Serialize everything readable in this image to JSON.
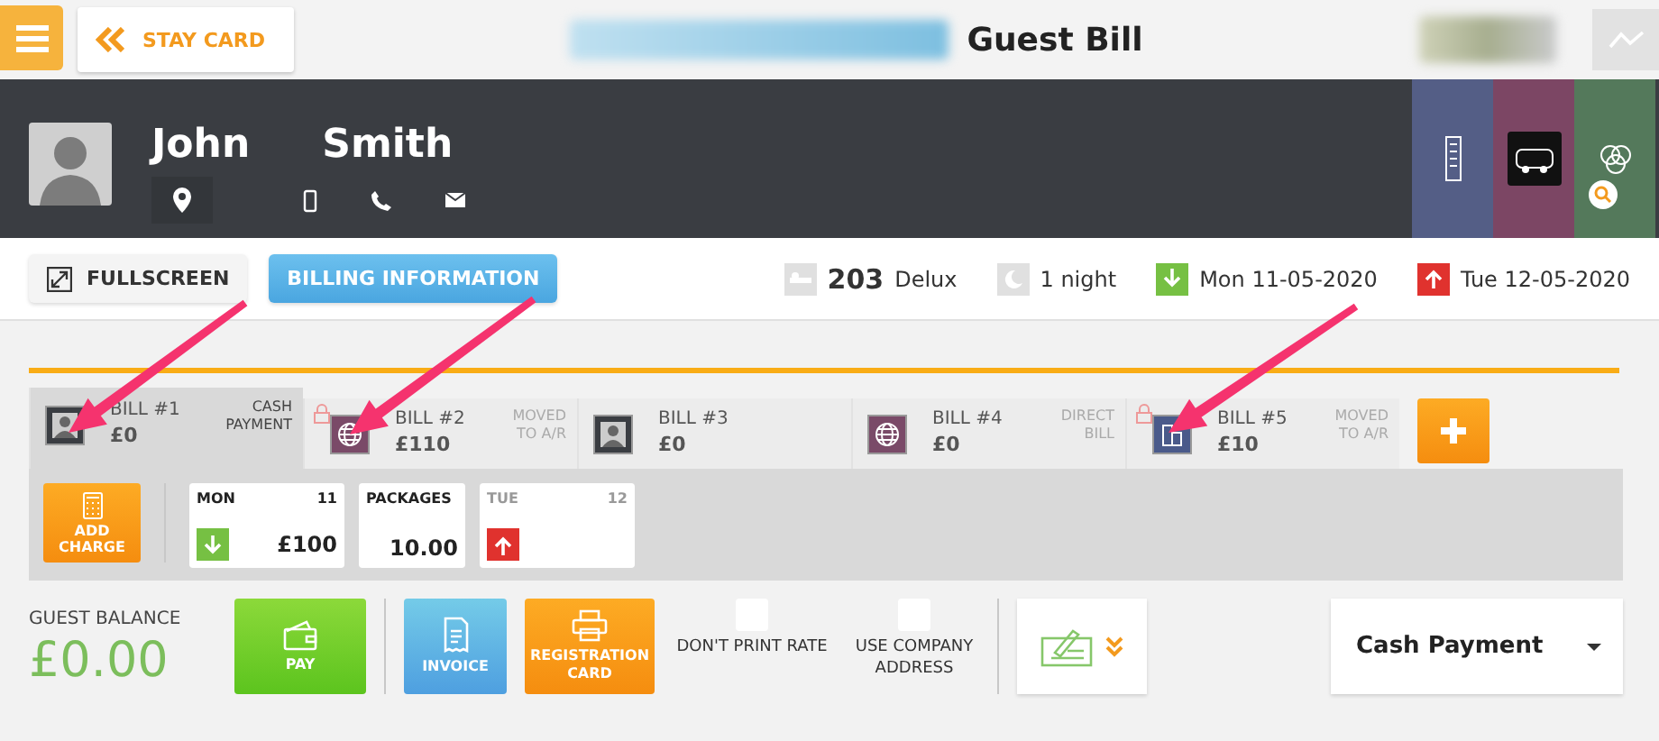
{
  "header": {
    "back_button": "STAY CARD",
    "title": "Guest Bill"
  },
  "guest": {
    "first_name": "John",
    "last_name": "Smith"
  },
  "toolbar": {
    "buttons": [
      {
        "label": "FULLSCREEN",
        "kind": "plain"
      },
      {
        "label": "BILLING INFORMATION",
        "kind": "primary"
      }
    ]
  },
  "stay": {
    "room": "203",
    "room_type": "Delux",
    "nights": "1 night",
    "arrival": "Mon 11-05-2020",
    "departure": "Tue 12-05-2020"
  },
  "bills": [
    {
      "label": "BILL #1",
      "amount": "£0",
      "status": "CASH PAYMENT",
      "kind": "guest",
      "locked": false,
      "selected": true
    },
    {
      "label": "BILL #2",
      "amount": "£110",
      "status": "MOVED TO A/R",
      "kind": "web",
      "locked": true,
      "selected": false
    },
    {
      "label": "BILL #3",
      "amount": "£0",
      "kind": "guest",
      "locked": false,
      "selected": false
    },
    {
      "label": "BILL #4",
      "amount": "£0",
      "status": "DIRECT BILL",
      "kind": "web",
      "locked": false,
      "selected": false
    },
    {
      "label": "BILL #5",
      "amount": "£10",
      "status": "MOVED TO A/R",
      "kind": "company",
      "locked": true,
      "selected": false
    }
  ],
  "add_charge": "ADD CHARGE",
  "days": [
    {
      "kind": "day",
      "day": "MON",
      "date": "11",
      "value": "£100",
      "arrival": true,
      "departure": false,
      "dimmed": false
    },
    {
      "kind": "packages",
      "label": "PACKAGES",
      "value": "10.00"
    },
    {
      "kind": "day",
      "day": "TUE",
      "date": "12",
      "arrival": false,
      "departure": true,
      "dimmed": true
    }
  ],
  "balance": {
    "label": "GUEST BALANCE",
    "amount": "£0.00"
  },
  "actions": [
    {
      "label": "PAY",
      "kind": "pay"
    },
    {
      "label": "INVOICE",
      "kind": "invoice"
    },
    {
      "label": "REGISTRATION CARD",
      "kind": "registration"
    }
  ],
  "options": [
    {
      "label": "DON'T PRINT RATE",
      "checked": false
    },
    {
      "label": "USE COMPANY ADDRESS",
      "checked": false
    }
  ],
  "payment_method": {
    "value": "Cash Payment"
  }
}
